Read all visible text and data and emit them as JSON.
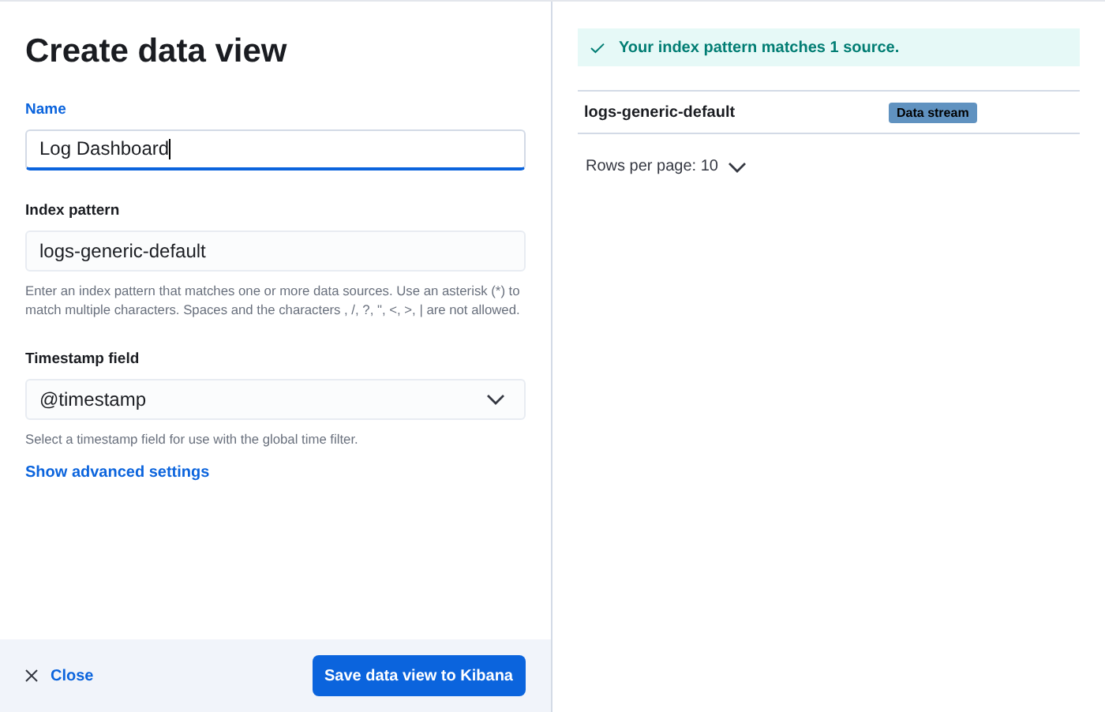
{
  "title": "Create data view",
  "fields": [
    {
      "kind": "input",
      "label": "Name",
      "value": "Log Dashboard",
      "focused": true
    },
    {
      "kind": "input",
      "label": "Index pattern",
      "value": "logs-generic-default",
      "focused": false,
      "help": "Enter an index pattern that matches one or more data sources. Use an asterisk (*) to match multiple characters. Spaces and the characters , /, ?, \", <, >, | are not allowed."
    },
    {
      "kind": "select",
      "label": "Timestamp field",
      "value": "@timestamp",
      "focused": false,
      "help": "Select a timestamp field for use with the global time filter."
    }
  ],
  "advanced_link": "Show advanced settings",
  "footer": {
    "close": "Close",
    "save": "Save data view to Kibana"
  },
  "callout": "Your index pattern matches 1 source.",
  "table": {
    "rows": [
      {
        "name": "logs-generic-default",
        "badge": "Data stream"
      }
    ]
  },
  "rows_per_page": "Rows per page: 10"
}
